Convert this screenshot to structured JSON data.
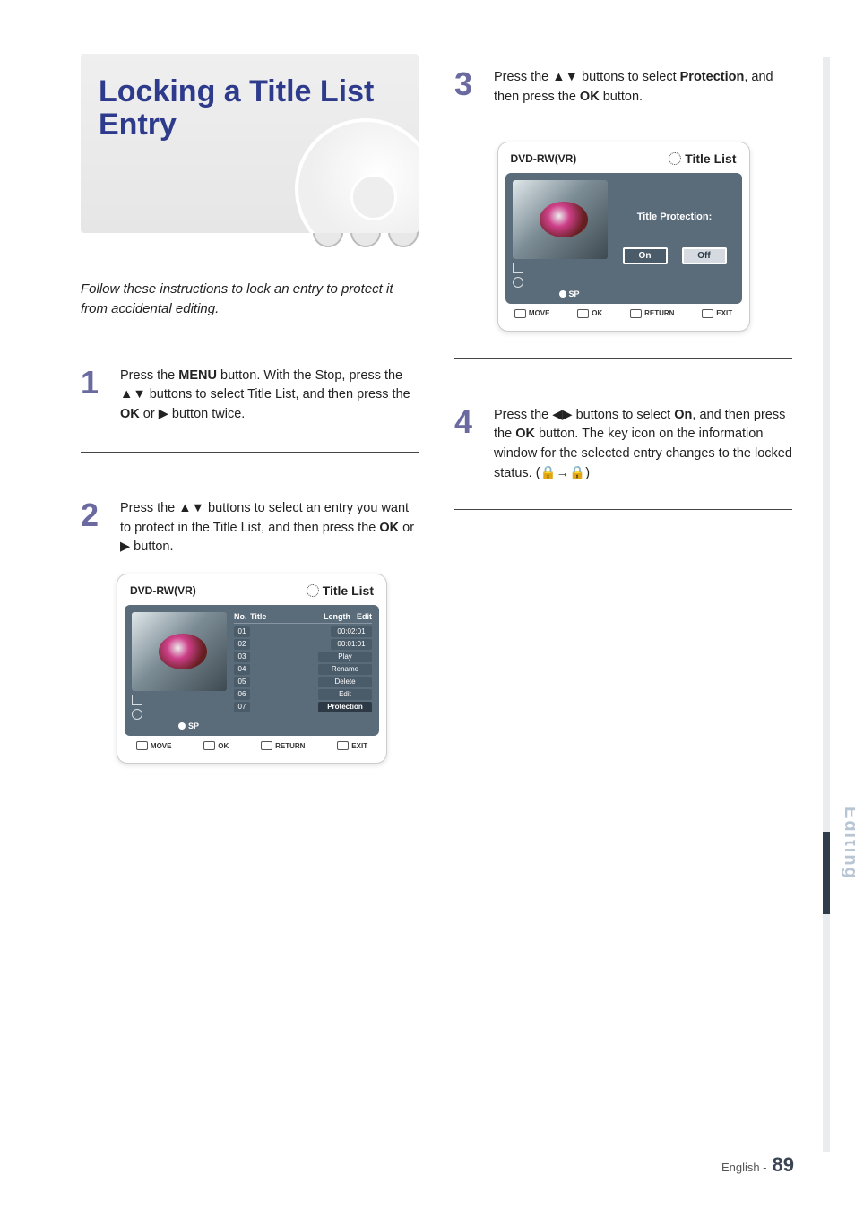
{
  "header": {
    "title": "Locking a Title List Entry",
    "discs": [
      "",
      "",
      ""
    ]
  },
  "intro": "Follow these instructions to lock an entry to protect it from accidental editing.",
  "steps_left": {
    "s1": {
      "num": "1",
      "text_before": "Press the ",
      "btn_a": "MENU",
      "text_mid_a": " button. With the Stop, press the ",
      "arrows_a": "▲▼",
      "text_mid_b": " buttons to select Title List, and then press the ",
      "btn_b": "OK",
      "text_mid_c": " or ",
      "arrow_right": "▶",
      "text_end": " button twice."
    },
    "s2": {
      "num": "2",
      "text_before": "Press the ",
      "arrows": "▲▼",
      "text_mid_a": " buttons to select an entry you want to protect in the Title List, and then press the ",
      "btn": "OK",
      "text_mid_b": " or ",
      "arrow_right": "▶",
      "text_end": " button."
    }
  },
  "steps_right": {
    "s3": {
      "num": "3",
      "text_before": "Press the ",
      "arrows": "▲▼",
      "text_mid_a": " buttons to select ",
      "kw": "Protection",
      "text_mid_b": ", and then press the ",
      "btn": "OK",
      "text_end": " button."
    },
    "s4": {
      "num": "4",
      "text_before": "Press the ",
      "arrows": "◀▶",
      "text_mid_a": " buttons to select ",
      "kw": "On",
      "text_mid_b": ", and then press the ",
      "btn": "OK",
      "text_mid_c": " button. The key icon on the information window for the selected entry changes to the locked status. (",
      "lock": "🔒",
      "text_mid_d": "→",
      "lock2": "🔒",
      "text_end": ")"
    }
  },
  "osd1": {
    "mode": "DVD-RW(VR)",
    "section": "Title List",
    "sp": "SP",
    "headers": {
      "no": "No.",
      "title": "Title",
      "length": "Length",
      "edit": "Edit"
    },
    "rows": [
      {
        "no": "01",
        "len": "00:02:01",
        "action": ""
      },
      {
        "no": "02",
        "len": "00:01:01",
        "action": ""
      },
      {
        "no": "03",
        "len": "",
        "action": "Play"
      },
      {
        "no": "04",
        "len": "",
        "action": "Rename"
      },
      {
        "no": "05",
        "len": "",
        "action": "Delete"
      },
      {
        "no": "06",
        "len": "",
        "action": "Edit"
      },
      {
        "no": "07",
        "len": "",
        "action": "Protection"
      }
    ],
    "footer": {
      "move": "MOVE",
      "ok": "OK",
      "return": "RETURN",
      "exit": "EXIT"
    }
  },
  "osd2": {
    "mode": "DVD-RW(VR)",
    "section": "Title List",
    "sp": "SP",
    "label": "Title Protection:",
    "on": "On",
    "off": "Off",
    "footer": {
      "move": "MOVE",
      "ok": "OK",
      "return": "RETURN",
      "exit": "EXIT"
    }
  },
  "side_tab": "Editing",
  "page_number": "89",
  "footer_note": "English -"
}
